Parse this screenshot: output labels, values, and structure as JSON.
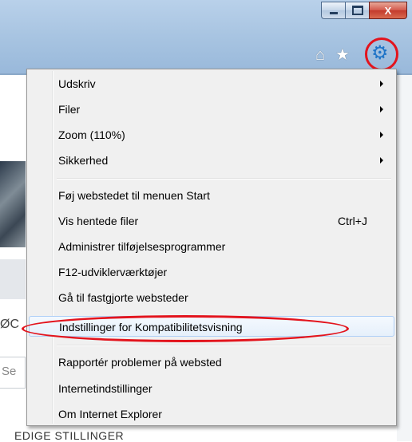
{
  "window": {
    "caption_buttons": {
      "minimize": "minimize",
      "maximize": "maximize",
      "close": "X"
    },
    "toolbar_icons": [
      "home-icon",
      "star-icon",
      "gear-icon"
    ],
    "annotation_color": "#e3141d",
    "gear_color": "#1f74c7"
  },
  "background_page": {
    "fragment_text": "ØC",
    "input_fragment": "Se",
    "footer_text": "EDIGE STILLINGER"
  },
  "menu": {
    "group1": [
      {
        "label": "Udskriv",
        "submenu": true
      },
      {
        "label": "Filer",
        "submenu": true
      },
      {
        "label": "Zoom (110%)",
        "submenu": true
      },
      {
        "label": "Sikkerhed",
        "submenu": true
      }
    ],
    "group2": [
      {
        "label": "Føj webstedet til menuen Start"
      },
      {
        "label": "Vis hentede filer",
        "shortcut": "Ctrl+J"
      },
      {
        "label": "Administrer tilføjelsesprogrammer"
      },
      {
        "label": "F12-udviklerværktøjer"
      },
      {
        "label": "Gå til fastgjorte websteder"
      },
      {
        "label": "Indstillinger for Kompatibilitetsvisning",
        "highlighted": true
      }
    ],
    "group3": [
      {
        "label": "Rapportér problemer på websted"
      },
      {
        "label": "Internetindstillinger"
      },
      {
        "label": "Om Internet Explorer"
      }
    ]
  }
}
